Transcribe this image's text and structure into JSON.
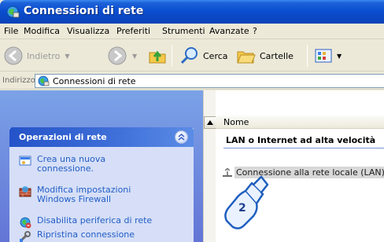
{
  "window": {
    "title": "Connessioni di rete"
  },
  "menu": [
    "File",
    "Modifica",
    "Visualizza",
    "Preferiti",
    "Strumenti",
    "Avanzate",
    "?"
  ],
  "toolbar": {
    "back_label": "Indietro",
    "search_label": "Cerca",
    "folders_label": "Cartelle"
  },
  "address": {
    "label": "Indirizzo",
    "value": "Connessioni di rete"
  },
  "taskpane": {
    "title": "Operazioni di rete",
    "tasks": [
      {
        "label": "Crea una nuova connessione.",
        "icon": "new-connection-icon"
      },
      {
        "label": "Modifica impostazioni Windows Firewall",
        "icon": "firewall-icon"
      },
      {
        "label": "Disabilita periferica di rete",
        "icon": "disable-device-icon"
      },
      {
        "label": "Ripristina connessione",
        "icon": "repair-connection-icon"
      }
    ]
  },
  "list": {
    "column_name": "Nome",
    "group_title": "LAN o Internet ad alta velocità",
    "item_label": "Connessione alla rete locale (LAN)"
  },
  "callout": {
    "number": "2"
  },
  "colors": {
    "titlebar": "#0a4fd1",
    "taskpane_bg": "#6f8ce0",
    "task_link": "#215dc6",
    "group_line": "#7996d9"
  }
}
